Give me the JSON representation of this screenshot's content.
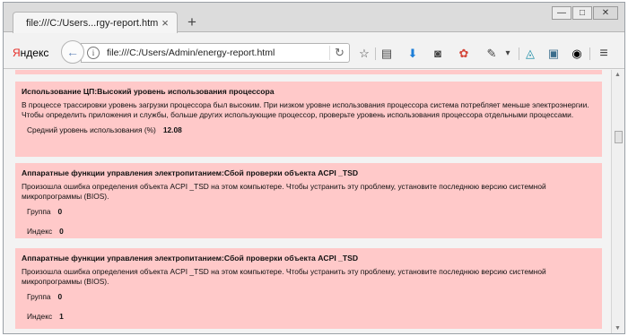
{
  "browser": {
    "tab_title": "file:///C:/Users...rgy-report.html",
    "tab_close": "×",
    "new_tab": "+",
    "window_controls": {
      "minimize": "—",
      "maximize": "□",
      "close": "✕"
    },
    "yandex_logo": {
      "first": "Я",
      "rest": "ндекс"
    },
    "back": "←",
    "url": "file:///C:/Users/Admin/energy-report.html",
    "reload": "↻",
    "toolbar_icons": [
      "star-icon",
      "reader-icon",
      "download-icon",
      "pocket-icon",
      "rainbow-icon",
      "eyedropper-icon",
      "dropdown-icon",
      "shield-icon",
      "photo-icon",
      "camera-icon",
      "menu-icon"
    ],
    "glyphs": {
      "star": "☆",
      "reader": "▤",
      "download": "⬇",
      "pocket": "◙",
      "rainbow": "✿",
      "eyedropper": "✎",
      "dropdown": "▾",
      "shield": "◬",
      "photo": "▣",
      "camera": "◉",
      "menu": "≡"
    }
  },
  "report": {
    "sections": [
      {
        "title": "Использование ЦП:Высокий уровень использования процессора",
        "description": "В процессе трассировки уровень загрузки процессора был высоким. При низком уровне использования процессора система потребляет меньше электроэнергии. Чтобы определить приложения и службы, больше других использующие процессор, проверьте уровень использования процессора отдельными процессами.",
        "fields": [
          {
            "label": "Средний уровень использования (%)",
            "value": "12.08"
          }
        ]
      },
      {
        "title": "Аппаратные функции управления электропитанием:Сбой проверки объекта ACPI _TSD",
        "description": "Произошла ошибка определения объекта ACPI _TSD на этом компьютере. Чтобы устранить эту проблему, установите последнюю версию системной микропрограммы (BIOS).",
        "fields": [
          {
            "label": "Группа",
            "value": "0"
          },
          {
            "label": "Индекс",
            "value": "0"
          }
        ]
      },
      {
        "title": "Аппаратные функции управления электропитанием:Сбой проверки объекта ACPI _TSD",
        "description": "Произошла ошибка определения объекта ACPI _TSD на этом компьютере. Чтобы устранить эту проблему, установите последнюю версию системной микропрограммы (BIOS).",
        "fields": [
          {
            "label": "Группа",
            "value": "0"
          },
          {
            "label": "Индекс",
            "value": "1"
          }
        ]
      }
    ]
  },
  "colors": {
    "block_bg": "#ffc9c9",
    "yandex_red": "#e52620"
  }
}
